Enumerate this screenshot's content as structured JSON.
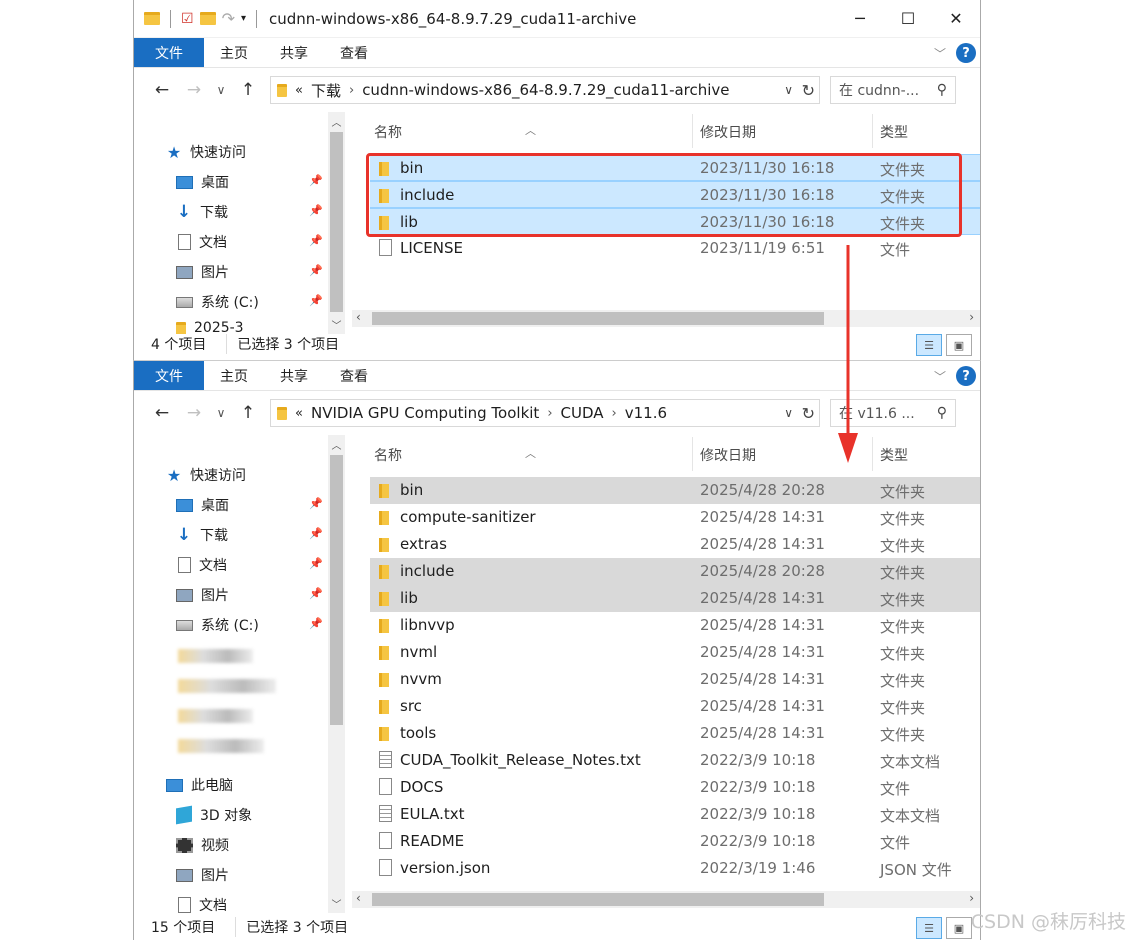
{
  "window1": {
    "title": "cudnn-windows-x86_64-8.9.7.29_cuda11-archive",
    "ribbon_tabs": [
      "文件",
      "主页",
      "共享",
      "查看"
    ],
    "address": {
      "prefix": "«",
      "segments": [
        "下载",
        "cudnn-windows-x86_64-8.9.7.29_cuda11-archive"
      ]
    },
    "search_placeholder": "在 cudnn-...",
    "nav": {
      "quick_access": "快速访问",
      "items": [
        "桌面",
        "下载",
        "文档",
        "图片",
        "系统 (C:)"
      ],
      "partial": "2025-3"
    },
    "columns": {
      "name": "名称",
      "date": "修改日期",
      "type": "类型"
    },
    "files": [
      {
        "name": "bin",
        "date": "2023/11/30 16:18",
        "type": "文件夹",
        "kind": "folder",
        "selected": true
      },
      {
        "name": "include",
        "date": "2023/11/30 16:18",
        "type": "文件夹",
        "kind": "folder",
        "selected": true
      },
      {
        "name": "lib",
        "date": "2023/11/30 16:18",
        "type": "文件夹",
        "kind": "folder",
        "selected": true
      },
      {
        "name": "LICENSE",
        "date": "2023/11/19 6:51",
        "type": "文件",
        "kind": "file",
        "selected": false
      }
    ],
    "status": {
      "count": "4 个项目",
      "selected": "已选择 3 个项目"
    }
  },
  "window2": {
    "ribbon_tabs": [
      "文件",
      "主页",
      "共享",
      "查看"
    ],
    "address": {
      "prefix": "«",
      "segments": [
        "NVIDIA GPU Computing Toolkit",
        "CUDA",
        "v11.6"
      ]
    },
    "search_placeholder": "在 v11.6 ...",
    "nav": {
      "quick_access": "快速访问",
      "items": [
        "桌面",
        "下载",
        "文档",
        "图片",
        "系统 (C:)"
      ],
      "this_pc": "此电脑",
      "pc_items": [
        "3D 对象",
        "视频",
        "图片",
        "文档"
      ]
    },
    "columns": {
      "name": "名称",
      "date": "修改日期",
      "type": "类型"
    },
    "files": [
      {
        "name": "bin",
        "date": "2025/4/28 20:28",
        "type": "文件夹",
        "kind": "folder",
        "selected": true
      },
      {
        "name": "compute-sanitizer",
        "date": "2025/4/28 14:31",
        "type": "文件夹",
        "kind": "folder",
        "selected": false
      },
      {
        "name": "extras",
        "date": "2025/4/28 14:31",
        "type": "文件夹",
        "kind": "folder",
        "selected": false
      },
      {
        "name": "include",
        "date": "2025/4/28 20:28",
        "type": "文件夹",
        "kind": "folder",
        "selected": true
      },
      {
        "name": "lib",
        "date": "2025/4/28 14:31",
        "type": "文件夹",
        "kind": "folder",
        "selected": true
      },
      {
        "name": "libnvvp",
        "date": "2025/4/28 14:31",
        "type": "文件夹",
        "kind": "folder",
        "selected": false
      },
      {
        "name": "nvml",
        "date": "2025/4/28 14:31",
        "type": "文件夹",
        "kind": "folder",
        "selected": false
      },
      {
        "name": "nvvm",
        "date": "2025/4/28 14:31",
        "type": "文件夹",
        "kind": "folder",
        "selected": false
      },
      {
        "name": "src",
        "date": "2025/4/28 14:31",
        "type": "文件夹",
        "kind": "folder",
        "selected": false
      },
      {
        "name": "tools",
        "date": "2025/4/28 14:31",
        "type": "文件夹",
        "kind": "folder",
        "selected": false
      },
      {
        "name": "CUDA_Toolkit_Release_Notes.txt",
        "date": "2022/3/9 10:18",
        "type": "文本文档",
        "kind": "txt",
        "selected": false
      },
      {
        "name": "DOCS",
        "date": "2022/3/9 10:18",
        "type": "文件",
        "kind": "file",
        "selected": false
      },
      {
        "name": "EULA.txt",
        "date": "2022/3/9 10:18",
        "type": "文本文档",
        "kind": "txt",
        "selected": false
      },
      {
        "name": "README",
        "date": "2022/3/9 10:18",
        "type": "文件",
        "kind": "file",
        "selected": false
      },
      {
        "name": "version.json",
        "date": "2022/3/19 1:46",
        "type": "JSON 文件",
        "kind": "file",
        "selected": false
      }
    ],
    "status": {
      "count": "15 个项目",
      "selected": "已选择 3 个项目"
    }
  },
  "watermark": "CSDN @秣厉科技",
  "colors": {
    "accent": "#1a6ec2",
    "selection": "#cce8ff",
    "highlight": "#e8322a"
  }
}
